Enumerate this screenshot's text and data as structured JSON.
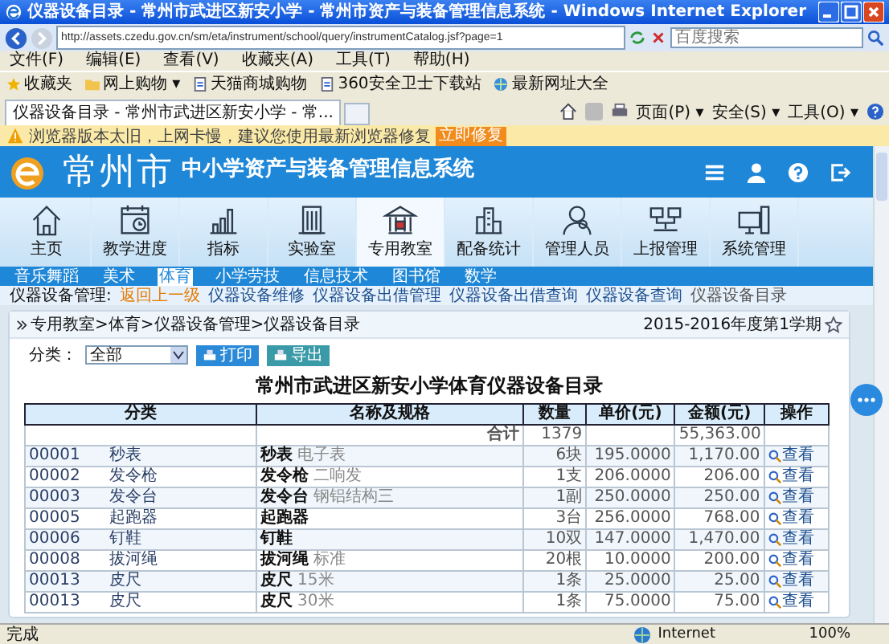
{
  "window": {
    "title": "仪器设备目录 - 常州市武进区新安小学 - 常州市资产与装备管理信息系统 - Windows Internet Explorer"
  },
  "address": {
    "value": "http://assets.czedu.gov.cn/sm/eta/instrument/school/query/instrumentCatalog.jsf?page=1"
  },
  "search": {
    "placeholder": "百度搜索"
  },
  "menu": [
    "文件(F)",
    "编辑(E)",
    "查看(V)",
    "收藏夹(A)",
    "工具(T)",
    "帮助(H)"
  ],
  "favorites": [
    {
      "label": "收藏夹",
      "kind": "star"
    },
    {
      "label": "网上购物 ▾",
      "kind": "folder"
    },
    {
      "label": "天猫商城购物",
      "kind": "page"
    },
    {
      "label": "360安全卫士下载站",
      "kind": "page"
    },
    {
      "label": "最新网址大全",
      "kind": "globe"
    }
  ],
  "tabs": [
    {
      "label": "仪器设备目录 - 常州市武进区新安小学 - 常...",
      "selected": true
    }
  ],
  "commands": [
    "页面(P) ▾",
    "安全(S) ▾",
    "工具(O) ▾"
  ],
  "warning": {
    "text": "浏览器版本太旧，上网卡慢，建议您使用最新浏览器修复",
    "button": "立即修复"
  },
  "header": {
    "city": "常州市",
    "system": "中小学资产与装备管理信息系统"
  },
  "nav": [
    {
      "label": "主页",
      "selected": false
    },
    {
      "label": "教学进度",
      "selected": false
    },
    {
      "label": "指标",
      "selected": false
    },
    {
      "label": "实验室",
      "selected": false
    },
    {
      "label": "专用教室",
      "selected": true
    },
    {
      "label": "配备统计",
      "selected": false
    },
    {
      "label": "管理人员",
      "selected": false
    },
    {
      "label": "上报管理",
      "selected": false
    },
    {
      "label": "系统管理",
      "selected": false
    }
  ],
  "subnav": [
    {
      "label": "音乐舞蹈",
      "selected": false
    },
    {
      "label": "美术",
      "selected": false
    },
    {
      "label": "体育",
      "selected": true
    },
    {
      "label": "小学劳技",
      "selected": false
    },
    {
      "label": "信息技术",
      "selected": false
    },
    {
      "label": "图书馆",
      "selected": false
    },
    {
      "label": "数学",
      "selected": false
    }
  ],
  "links": {
    "label": "仪器设备管理:",
    "items": [
      {
        "label": "返回上一级",
        "kind": "back"
      },
      {
        "label": "仪器设备维修",
        "kind": "link"
      },
      {
        "label": "仪器设备出借管理",
        "kind": "link"
      },
      {
        "label": "仪器设备出借查询",
        "kind": "link"
      },
      {
        "label": "仪器设备查询",
        "kind": "link"
      },
      {
        "label": "仪器设备目录",
        "kind": "current"
      }
    ]
  },
  "breadcrumb": "专用教室>体育>仪器设备管理>仪器设备目录",
  "term": "2015-2016年度第1学期",
  "filter": {
    "label": "分类：",
    "value": "全部",
    "buttons": [
      "打印",
      "导出"
    ]
  },
  "report_title": "常州市武进区新安小学体育仪器设备目录",
  "table": {
    "columns": [
      "分类",
      "名称及规格",
      "数量",
      "单价(元)",
      "金额(元)",
      "操作"
    ],
    "total": {
      "label": "合计",
      "quantity": "1379",
      "amount": "55,363.00"
    },
    "rows": [
      {
        "code": "00001",
        "category": "秒表",
        "name": "**秒表** 电子表",
        "quantity": "6块",
        "price": "195.0000",
        "amount": "1,170.00",
        "action": "查看"
      },
      {
        "code": "00002",
        "category": "发令枪",
        "name": "**发令枪** 二响发",
        "quantity": "1支",
        "price": "206.0000",
        "amount": "206.00",
        "action": "查看"
      },
      {
        "code": "00003",
        "category": "发令台",
        "name": "**发令台** 钢铝结构三",
        "quantity": "1副",
        "price": "250.0000",
        "amount": "250.00",
        "action": "查看"
      },
      {
        "code": "00005",
        "category": "起跑器",
        "name": "**起跑器**",
        "quantity": "3台",
        "price": "256.0000",
        "amount": "768.00",
        "action": "查看"
      },
      {
        "code": "00006",
        "category": "钉鞋",
        "name": "**钉鞋**",
        "quantity": "10双",
        "price": "147.0000",
        "amount": "1,470.00",
        "action": "查看"
      },
      {
        "code": "00008",
        "category": "拔河绳",
        "name": "**拔河绳** 标准",
        "quantity": "20根",
        "price": "10.0000",
        "amount": "200.00",
        "action": "查看"
      },
      {
        "code": "00013",
        "category": "皮尺",
        "name": "**皮尺** 15米",
        "quantity": "1条",
        "price": "25.0000",
        "amount": "25.00",
        "action": "查看"
      },
      {
        "code": "00013",
        "category": "皮尺",
        "name": "**皮尺** 30米",
        "quantity": "1条",
        "price": "75.0000",
        "amount": "75.00",
        "action": "查看"
      }
    ]
  },
  "status": {
    "text": "完成",
    "zone": "Internet",
    "zoom": "100%"
  }
}
